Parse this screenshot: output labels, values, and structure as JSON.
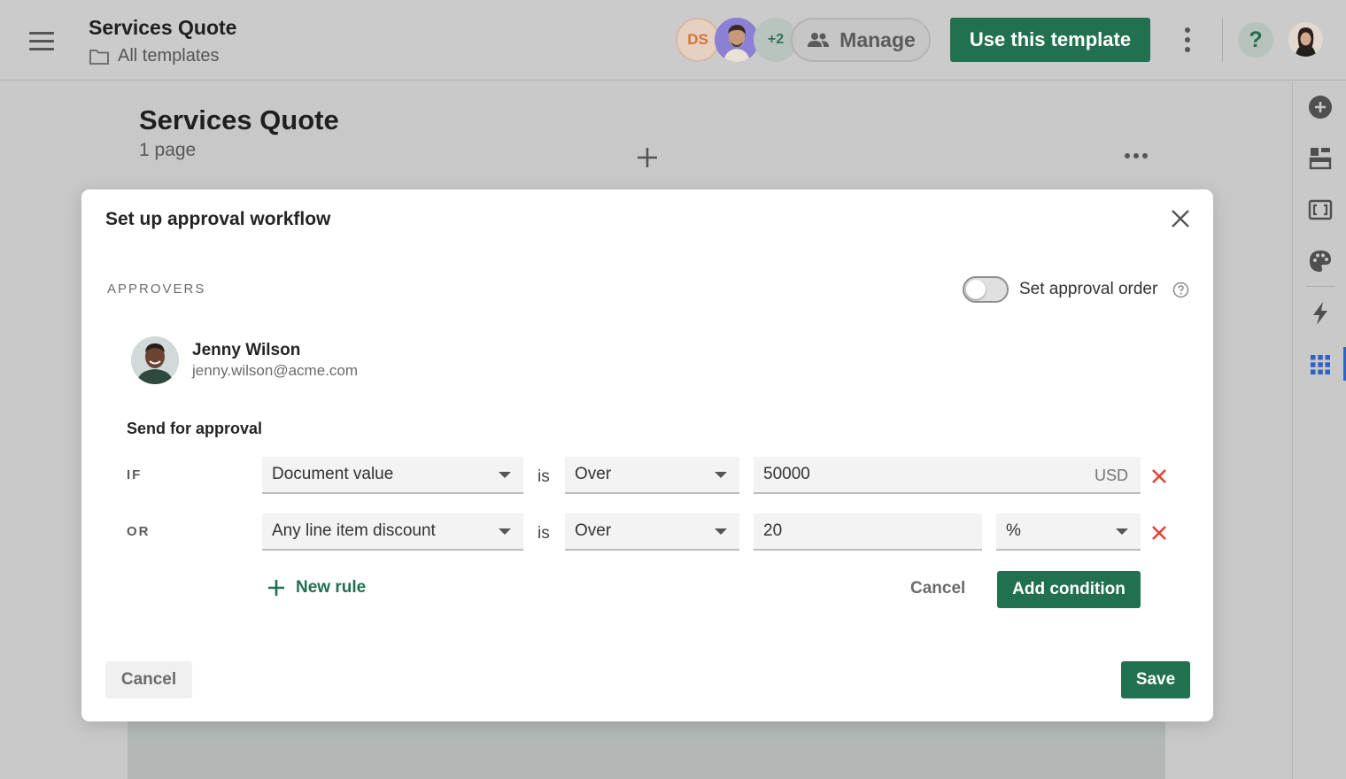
{
  "header": {
    "title": "Services Quote",
    "breadcrumb": "All templates",
    "collaborators": {
      "initials": "DS",
      "more": "+2"
    },
    "manage_label": "Manage",
    "use_template_label": "Use this template",
    "help_label": "?"
  },
  "editor": {
    "title": "Services Quote",
    "subtitle": "1 page"
  },
  "modal": {
    "title": "Set up approval workflow",
    "approvers_label": "APPROVERS",
    "approval_order_label": "Set approval order",
    "approval_order_enabled": false,
    "approver": {
      "name": "Jenny Wilson",
      "email": "jenny.wilson@acme.com"
    },
    "send_label": "Send for approval",
    "conditions": [
      {
        "keyword": "IF",
        "field": "Document value",
        "operator_text": "is",
        "comparator": "Over",
        "value": "50000",
        "unit": "USD"
      },
      {
        "keyword": "OR",
        "field": "Any line item discount",
        "operator_text": "is",
        "comparator": "Over",
        "value": "20",
        "unit": "%"
      }
    ],
    "new_rule_label": "New rule",
    "inline_cancel_label": "Cancel",
    "add_condition_label": "Add condition",
    "cancel_label": "Cancel",
    "save_label": "Save"
  },
  "colors": {
    "primary": "#21704f",
    "danger": "#e0413a",
    "rail_active": "#2e63c8"
  },
  "rail_icons": [
    "add-circle-icon",
    "blocks-icon",
    "variables-icon",
    "palette-icon",
    "lightning-icon",
    "apps-grid-icon"
  ]
}
